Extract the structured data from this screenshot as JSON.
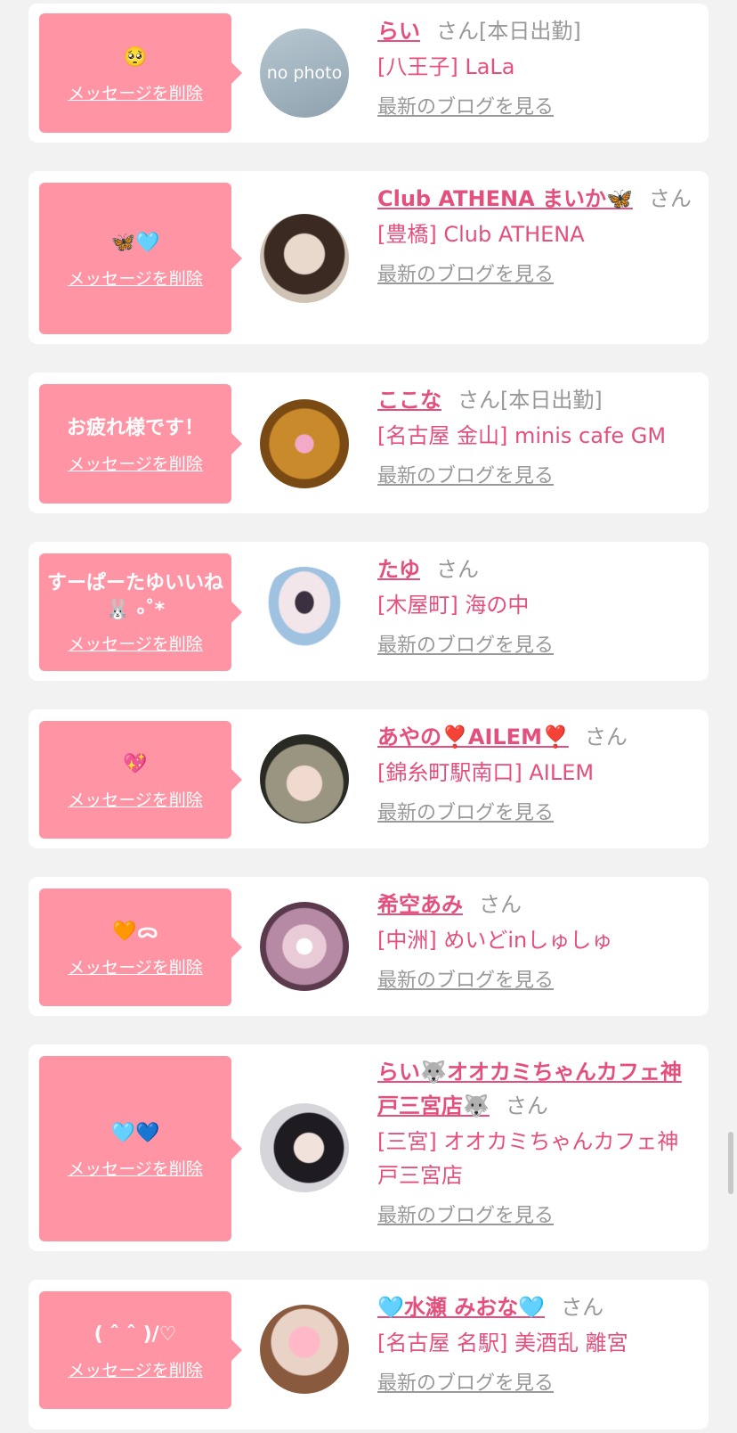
{
  "delete_label": "メッセージを削除",
  "blog_label": "最新のブログを見る",
  "san_label": "さん",
  "entries": [
    {
      "message": "🥺",
      "name": "らい",
      "status": "[本日出勤]",
      "shop": "[八王子] LaLa",
      "avatar_text": "no photo"
    },
    {
      "message": "🦋🩵",
      "name": "Club ATHENA まいか🦋",
      "status": "",
      "shop": "[豊橋] Club ATHENA",
      "avatar_text": ""
    },
    {
      "message": "お疲れ様です！",
      "name": "ここな",
      "status": "[本日出勤]",
      "shop": "[名古屋 金山] minis cafe GM",
      "avatar_text": ""
    },
    {
      "message": "すーぱーたゆいいね🐰 ৹˚*",
      "name": "たゆ",
      "status": "",
      "shop": "[木屋町] 海の中",
      "avatar_text": ""
    },
    {
      "message": "💖",
      "name": "あやの❣️AILEM❣️",
      "status": "",
      "shop": "[錦糸町駅南口] AILEM",
      "avatar_text": ""
    },
    {
      "message": "🧡ᯅ",
      "name": "希空あみ",
      "status": "",
      "shop": "[中洲] めいどinしゅしゅ",
      "avatar_text": ""
    },
    {
      "message": "🩵💙",
      "name": "らい🐺オオカミちゃんカフェ神戸三宮店🐺",
      "status": "",
      "shop": "[三宮] オオカミちゃんカフェ神戸三宮店",
      "avatar_text": ""
    },
    {
      "message": "( ˆ ˆ )/♡",
      "name": "🩵水瀬 みおな🩵",
      "status": "",
      "shop": "[名古屋 名駅] 美酒乱 離宮",
      "avatar_text": ""
    }
  ],
  "colors": {
    "bubble": "#ff95a4",
    "name": "#e4507e",
    "muted": "#999999",
    "background": "#f2f2f2"
  }
}
